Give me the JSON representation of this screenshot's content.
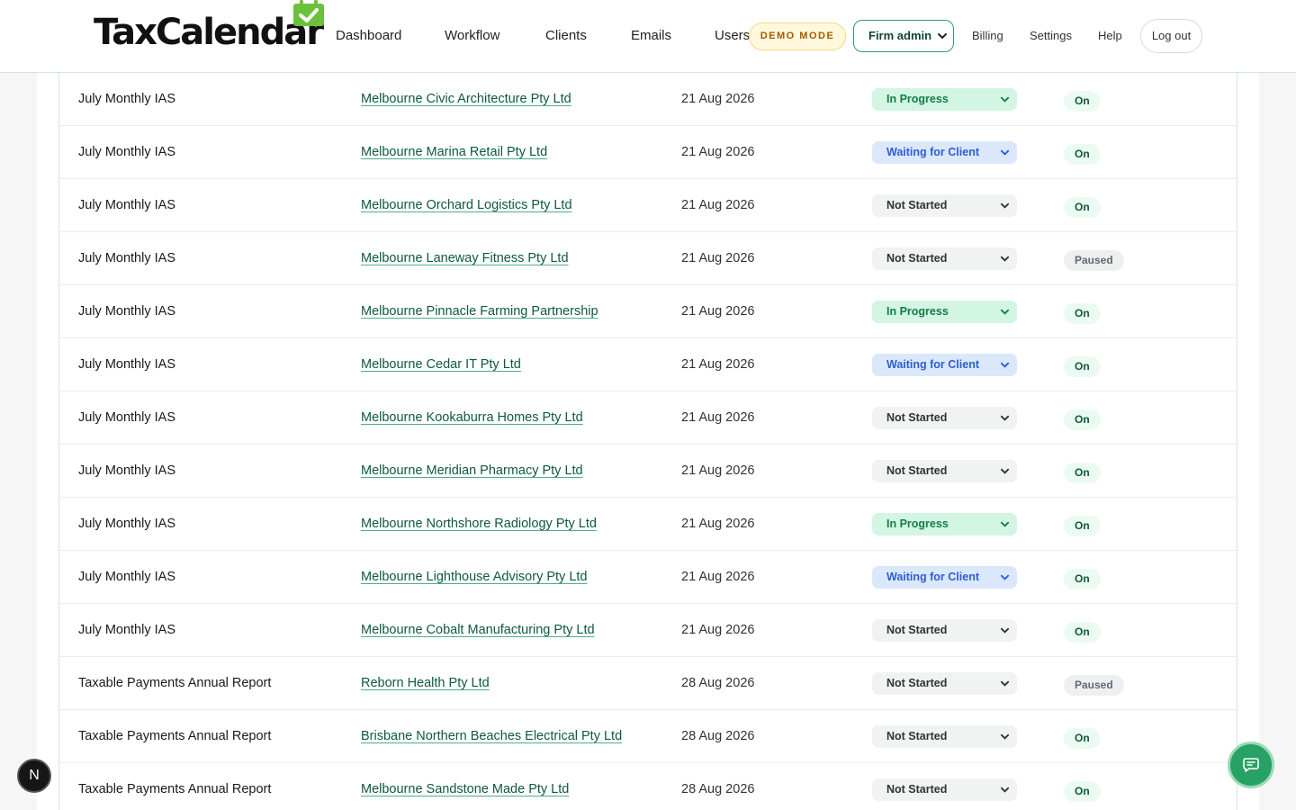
{
  "header": {
    "logo_text": "TaxCalendar",
    "nav": [
      "Dashboard",
      "Workflow",
      "Clients",
      "Emails",
      "Users"
    ],
    "demo_badge": "DEMO MODE",
    "firm_select": "Firm admin",
    "links": [
      "Billing",
      "Settings",
      "Help"
    ],
    "logout": "Log out"
  },
  "colors": {
    "brand_green": "#2e9c6c",
    "in_progress": "#137d47",
    "waiting": "#2d5ed1"
  },
  "rows": [
    {
      "task": "July Monthly IAS",
      "client": "Melbourne Civic Architecture Pty Ltd",
      "due": "21 Aug 2026",
      "status": "In Progress",
      "reminders": "On"
    },
    {
      "task": "July Monthly IAS",
      "client": "Melbourne Marina Retail Pty Ltd",
      "due": "21 Aug 2026",
      "status": "Waiting for Client",
      "reminders": "On"
    },
    {
      "task": "July Monthly IAS",
      "client": "Melbourne Orchard Logistics Pty Ltd",
      "due": "21 Aug 2026",
      "status": "Not Started",
      "reminders": "On"
    },
    {
      "task": "July Monthly IAS",
      "client": "Melbourne Laneway Fitness Pty Ltd",
      "due": "21 Aug 2026",
      "status": "Not Started",
      "reminders": "Paused"
    },
    {
      "task": "July Monthly IAS",
      "client": "Melbourne Pinnacle Farming Partnership",
      "due": "21 Aug 2026",
      "status": "In Progress",
      "reminders": "On"
    },
    {
      "task": "July Monthly IAS",
      "client": "Melbourne Cedar IT Pty Ltd",
      "due": "21 Aug 2026",
      "status": "Waiting for Client",
      "reminders": "On"
    },
    {
      "task": "July Monthly IAS",
      "client": "Melbourne Kookaburra Homes Pty Ltd",
      "due": "21 Aug 2026",
      "status": "Not Started",
      "reminders": "On"
    },
    {
      "task": "July Monthly IAS",
      "client": "Melbourne Meridian Pharmacy Pty Ltd",
      "due": "21 Aug 2026",
      "status": "Not Started",
      "reminders": "On"
    },
    {
      "task": "July Monthly IAS",
      "client": "Melbourne Northshore Radiology Pty Ltd",
      "due": "21 Aug 2026",
      "status": "In Progress",
      "reminders": "On"
    },
    {
      "task": "July Monthly IAS",
      "client": "Melbourne Lighthouse Advisory Pty Ltd",
      "due": "21 Aug 2026",
      "status": "Waiting for Client",
      "reminders": "On"
    },
    {
      "task": "July Monthly IAS",
      "client": "Melbourne Cobalt Manufacturing Pty Ltd",
      "due": "21 Aug 2026",
      "status": "Not Started",
      "reminders": "On"
    },
    {
      "task": "Taxable Payments Annual Report",
      "client": "Reborn Health Pty Ltd",
      "due": "28 Aug 2026",
      "status": "Not Started",
      "reminders": "Paused"
    },
    {
      "task": "Taxable Payments Annual Report",
      "client": "Brisbane Northern Beaches Electrical Pty Ltd",
      "due": "28 Aug 2026",
      "status": "Not Started",
      "reminders": "On"
    },
    {
      "task": "Taxable Payments Annual Report",
      "client": "Melbourne Sandstone Made Pty Ltd",
      "due": "28 Aug 2026",
      "status": "Not Started",
      "reminders": "On"
    }
  ],
  "floating": {
    "next_badge": "N",
    "chat_icon": "chat-icon"
  }
}
